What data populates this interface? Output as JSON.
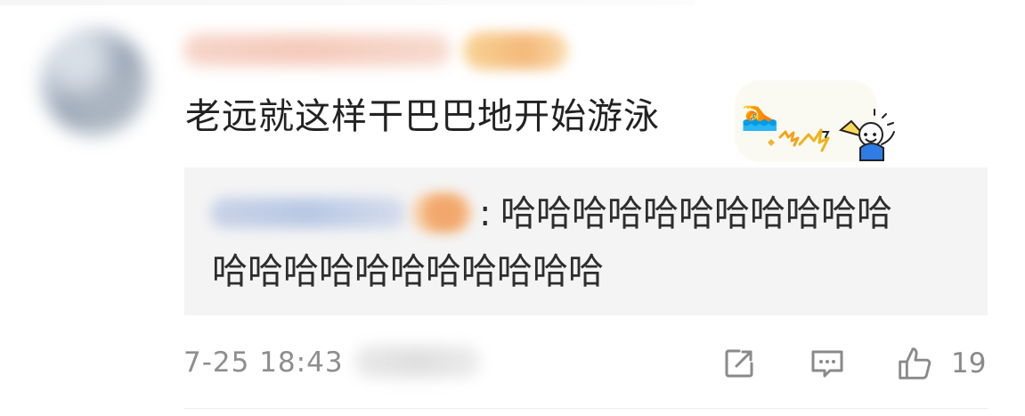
{
  "comment": {
    "text": "老远就这样干巴巴地开始游泳",
    "emoji": "🏊"
  },
  "reply": {
    "colon": ":",
    "line1": "哈哈哈哈哈哈哈哈哈哈哈",
    "line2": "哈哈哈哈哈哈哈哈哈哈哈"
  },
  "meta": {
    "timestamp": "7-25 18:43"
  },
  "actions": {
    "like_count": "19"
  },
  "icons": {
    "share": "share-icon",
    "comment": "comment-icon",
    "like": "thumbs-up-icon",
    "sticker": "cheer-sticker-icon",
    "swimmer": "swimmer-emoji-icon"
  },
  "colors": {
    "text": "#222222",
    "muted": "#8e8e8e",
    "reply_background": "#f4f4f4",
    "icon_gray": "#8a8a8a"
  }
}
